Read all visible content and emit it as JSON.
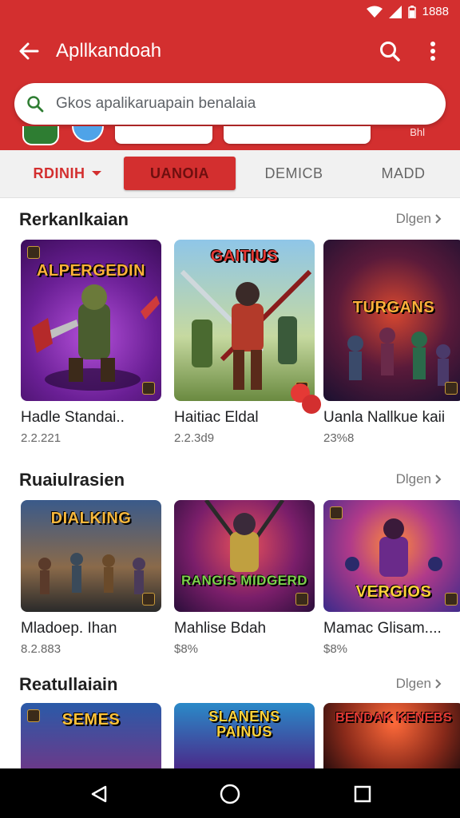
{
  "status": {
    "time": "1888"
  },
  "appbar": {
    "title": "Apllkandoah",
    "color": "#d32f2f"
  },
  "search": {
    "placeholder": "Gkos apalikaruapain benalaia"
  },
  "chips": {
    "right_text": "Bhl"
  },
  "tabs": [
    {
      "label": "RDINIH",
      "state": "dropdown"
    },
    {
      "label": "UANOIA",
      "state": "selected"
    },
    {
      "label": "DEMICB",
      "state": "normal"
    },
    {
      "label": "MADD",
      "state": "normal"
    }
  ],
  "sections": [
    {
      "title": "Rerkanlkaian",
      "more": "Dlgen",
      "items": [
        {
          "title": "Hadle Standai..",
          "sub": "2.2.221",
          "banner": "ALPERGEDIN",
          "bg": "purple"
        },
        {
          "title": "Haitiac Eldal",
          "sub": "2.2.3d9",
          "banner": "GAITIUS",
          "bg": "green"
        },
        {
          "title": "Uanla Nallkue kaii",
          "sub": "23%8",
          "banner": "TURGANS",
          "bg": "dark"
        }
      ]
    },
    {
      "title": "Ruaiulrasien",
      "more": "Dlgen",
      "items": [
        {
          "title": "Mladoep. Ihan",
          "sub": "8.2.883",
          "banner": "DIALKING",
          "bg": "blue"
        },
        {
          "title": "Mahlise Bdah",
          "sub": "$8%",
          "banner": "RANGIS MIDGERD",
          "bg": "red"
        },
        {
          "title": "Mamac Glisam....",
          "sub": "$8%",
          "banner": "VERGIOS",
          "bg": "violet"
        }
      ]
    },
    {
      "title": "Reatullaiain",
      "more": "Dlgen",
      "items": [
        {
          "title": "",
          "sub": "",
          "banner": "SEMES",
          "bg": "blue"
        },
        {
          "title": "",
          "sub": "",
          "banner": "SLANENS PAINUS",
          "bg": "teal"
        },
        {
          "title": "",
          "sub": "",
          "banner": "BENDAK KENEBS",
          "bg": "orange"
        }
      ]
    }
  ]
}
